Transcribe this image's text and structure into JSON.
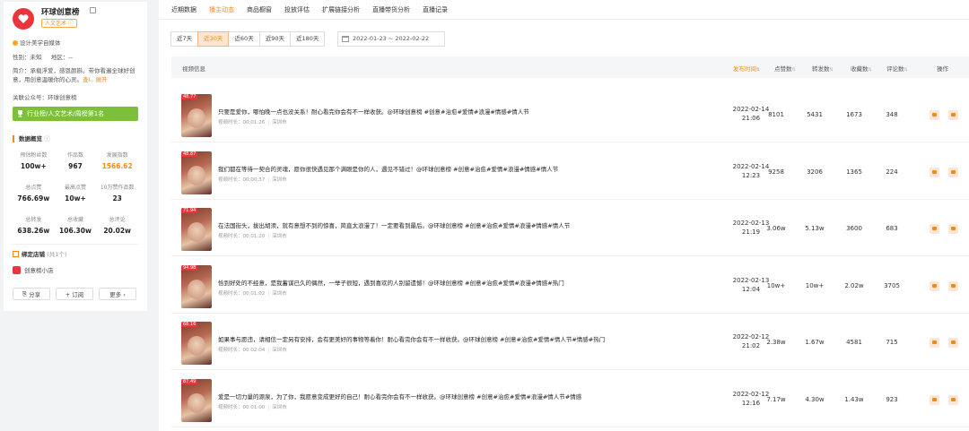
{
  "profile": {
    "name": "环球创意榜",
    "tag": "人文艺术 ⓘ",
    "cert": "设计美学自媒体",
    "gender": "性别：未知",
    "region": "地区：--",
    "intro": "简介：承载浮爱，感恩颜斟。带你看遍全球好创意，用创意温暖你的心灵。",
    "intro_more": "查I.. 展开",
    "account": "关联公众号：环球创意榜",
    "rank": "行业榜/人文艺术/周榜第1名"
  },
  "overview": {
    "title": "数据概览",
    "sub": "ⓘ",
    "stats": [
      {
        "k": "预估粉丝数",
        "v": "100w+",
        "orange": false
      },
      {
        "k": "作品数",
        "v": "967",
        "orange": false
      },
      {
        "k": "发展指数",
        "v": "1566.62",
        "orange": true
      },
      {
        "k": "总点赞",
        "v": "766.69w",
        "orange": false
      },
      {
        "k": "最高点赞",
        "v": "10w+",
        "orange": false
      },
      {
        "k": "10万赞作品数",
        "v": "23",
        "orange": false
      },
      {
        "k": "总转发",
        "v": "638.26w",
        "orange": false
      },
      {
        "k": "总收藏",
        "v": "106.30w",
        "orange": false
      },
      {
        "k": "总评论",
        "v": "20.02w",
        "orange": false
      }
    ]
  },
  "shop": {
    "title": "绑定店铺",
    "sub": "(共1个)",
    "name": "创意榜小店"
  },
  "actions": {
    "share": "分享",
    "follow": "+ 订阅",
    "more": "更多 ›"
  },
  "tabs": [
    "近期数据",
    "播主动态",
    "商品橱窗",
    "投放评估",
    "扩展链接分析",
    "直播带货分析",
    "直播记录"
  ],
  "active_tab": 1,
  "ranges": [
    "近7天",
    "近30天",
    "近60天",
    "近90天",
    "近180天"
  ],
  "active_range": 1,
  "date_range": "2022-01-23  ~  2022-02-22",
  "columns": {
    "info": "视频信息",
    "date": "发布时间",
    "likes": "点赞数",
    "shares": "转发数",
    "favs": "收藏数",
    "comments": "评论数",
    "ops": "操作"
  },
  "sort_mark": "⇅",
  "videos": [
    {
      "score": "48.77",
      "title": "只要是爱你，哪怕晚一点也没关系！耐心看完你会有不一样收获。@环球创意榜 #创意#治愈#爱情#浪漫#情感#情人节",
      "duration": "视频时长：00:01:26",
      "city": "深圳市",
      "date1": "2022-02-14",
      "date2": "21:06",
      "likes": "8101",
      "shares": "5431",
      "favs": "1673",
      "comments": "348"
    },
    {
      "score": "48.87",
      "title": "我们都在等待一契合的灵魂，愿你很快遇见那个满眼是你的人，遇见不错过！@环球创意榜 #创意#治愈#爱情#浪漫#情感#情人节",
      "duration": "视频时长：00:00:37",
      "city": "深圳市",
      "date1": "2022-02-14",
      "date2": "12:23",
      "likes": "9258",
      "shares": "3206",
      "favs": "1365",
      "comments": "224"
    },
    {
      "score": "71.94",
      "title": "在法国街头，拔出胡须，就有意想不到的惊喜，简直太浪漫了！一定要看到最后。@环球创意榜 #创意#治愈#爱情#浪漫#情感#情人节",
      "duration": "视频时长：00:01:20",
      "city": "深圳市",
      "date1": "2022-02-13",
      "date2": "21:19",
      "likes": "3.06w",
      "shares": "5.13w",
      "favs": "3600",
      "comments": "683"
    },
    {
      "score": "94.98",
      "title": "恰到好处的不经意，是我蓄谋已久的偶然，一举子很短，遇到喜欢的人别留遗憾！@环球创意榜 #创意#治愈#爱情#浪漫#情感#热门",
      "duration": "视频时长：00:01:02",
      "city": "深圳市",
      "date1": "2022-02-13",
      "date2": "12:04",
      "likes": "10w+",
      "shares": "10w+",
      "favs": "2.02w",
      "comments": "3705"
    },
    {
      "score": "68.16",
      "title": "如果事与愿违，请相信一定另有安排，会有更美好的事物等着你！耐心看完你会有不一样收获。@环球创意榜 #创意#治愈#爱情#情人节#情感#热门",
      "duration": "视频时长：00:02:04",
      "city": "深圳市",
      "date1": "2022-02-12",
      "date2": "21:02",
      "likes": "2.38w",
      "shares": "1.67w",
      "favs": "4581",
      "comments": "715"
    },
    {
      "score": "87.49",
      "title": "爱是一切力量的源泉，为了你，我愿意变成更好的自己！耐心看完你会有不一样收获。@环球创意榜 #创意#治愈#爱情#浪漫#情人节#情感",
      "duration": "视频时长：00:01:00",
      "city": "深圳市",
      "date1": "2022-02-12",
      "date2": "12:16",
      "likes": "7.17w",
      "shares": "4.30w",
      "favs": "1.43w",
      "comments": "923"
    }
  ],
  "colors": {
    "accent": "#f08a1c",
    "brand_red": "#e8363c",
    "rank_green": "#7cc03a"
  }
}
